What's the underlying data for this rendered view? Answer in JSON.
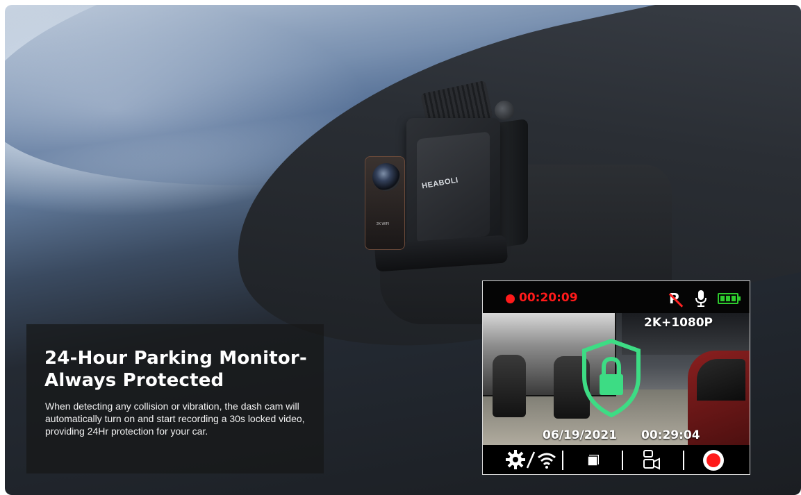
{
  "product": {
    "brand_logo": "HEABOLI",
    "lens_marking": "2K WIFI"
  },
  "info_panel": {
    "title": "24-Hour Parking Monitor-Always Protected",
    "body": "When detecting any collision or vibration, the dash cam will automatically turn on and start recording a 30s locked video, providing 24Hr protection for your car."
  },
  "screen": {
    "rec_time": "00:20:09",
    "resolution": "2K+1080P",
    "date": "06/19/2021",
    "time": "00:29:04",
    "status_icons": [
      "parking-off-icon",
      "microphone-icon",
      "battery-full-icon"
    ],
    "toolbar_icons": [
      "gear-icon",
      "wifi-icon",
      "photo-mode-icon",
      "camera-switch-icon",
      "record-icon"
    ],
    "colors": {
      "recording": "#ff1a1a",
      "battery": "#2ecc2e",
      "shield": "#3ddc84"
    }
  }
}
